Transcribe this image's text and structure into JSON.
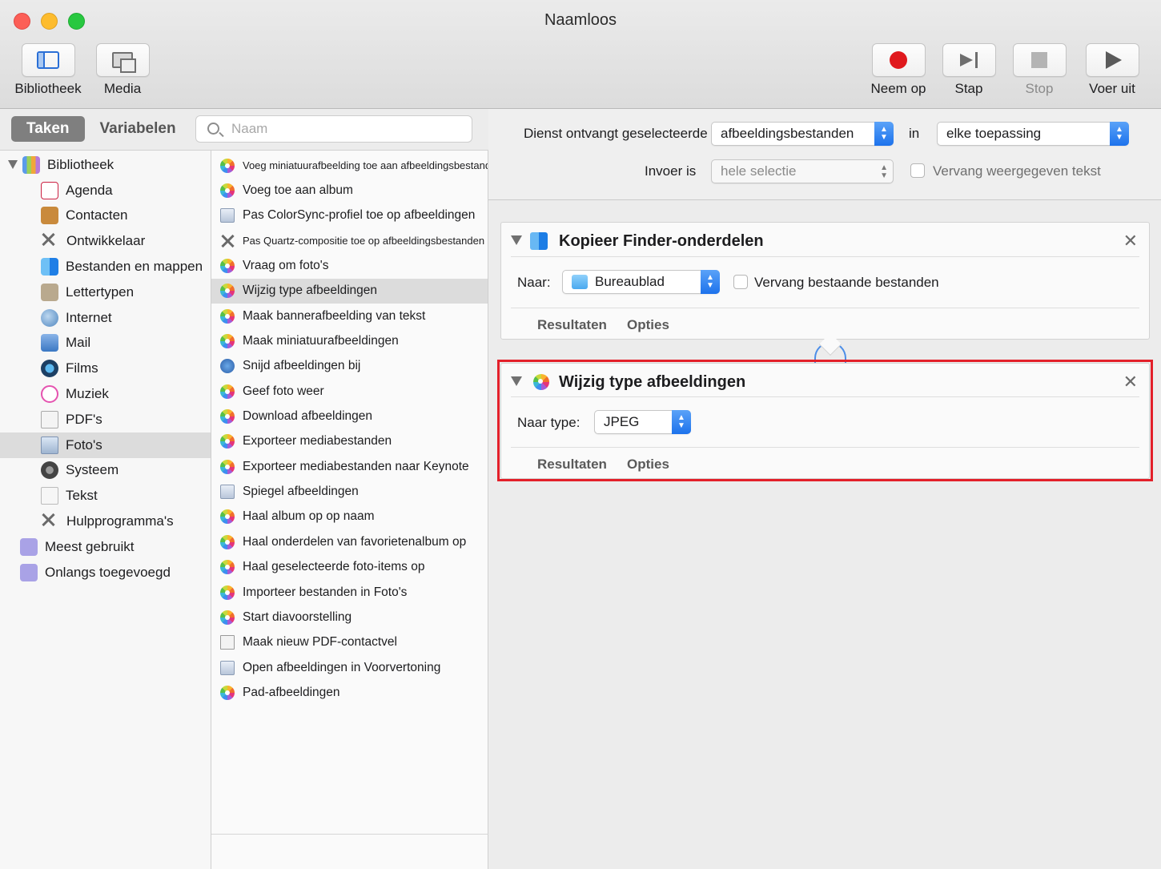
{
  "window": {
    "title": "Naamloos"
  },
  "toolbar": {
    "left": [
      {
        "label": "Bibliotheek",
        "icon": "library-icon"
      },
      {
        "label": "Media",
        "icon": "media-icon"
      }
    ],
    "right": [
      {
        "label": "Neem op",
        "icon": "record-icon"
      },
      {
        "label": "Stap",
        "icon": "step-icon"
      },
      {
        "label": "Stop",
        "icon": "stop-icon"
      },
      {
        "label": "Voer uit",
        "icon": "run-icon"
      }
    ]
  },
  "library": {
    "tabs": {
      "active": "Taken",
      "inactive": "Variabelen"
    },
    "search_placeholder": "Naam",
    "root": "Bibliotheek",
    "items": [
      "Agenda",
      "Contacten",
      "Ontwikkelaar",
      "Bestanden en mappen",
      "Lettertypen",
      "Internet",
      "Mail",
      "Films",
      "Muziek",
      "PDF's",
      "Foto's",
      "Systeem",
      "Tekst",
      "Hulpprogramma's"
    ],
    "selected": "Foto's",
    "smart_groups": [
      "Meest gebruikt",
      "Onlangs toegevoegd"
    ]
  },
  "actions": {
    "items": [
      "Voeg miniatuurafbeelding toe aan afbeeldingsbestanden",
      "Voeg toe aan album",
      "Pas ColorSync-profiel toe op afbeeldingen",
      "Pas Quartz-compositie toe op afbeeldingsbestanden",
      "Vraag om foto's",
      "Wijzig type afbeeldingen",
      "Maak bannerafbeelding van tekst",
      "Maak miniatuurafbeeldingen",
      "Snijd afbeeldingen bij",
      "Geef foto weer",
      "Download afbeeldingen",
      "Exporteer mediabestanden",
      "Exporteer mediabestanden naar Keynote",
      "Spiegel afbeeldingen",
      "Haal album op op naam",
      "Haal onderdelen van favorietenalbum op",
      "Haal geselecteerde foto-items op",
      "Importeer bestanden in Foto's",
      "Start diavoorstelling",
      "Maak nieuw PDF-contactvel",
      "Open afbeeldingen in Voorvertoning",
      "Pad-afbeeldingen"
    ],
    "selected": "Wijzig type afbeeldingen"
  },
  "service": {
    "receives_label": "Dienst ontvangt geselecteerde",
    "receives_value": "afbeeldingsbestanden",
    "in_label": "in",
    "in_value": "elke toepassing",
    "input_label": "Invoer is",
    "input_value": "hele selectie",
    "replace_label": "Vervang weergegeven tekst"
  },
  "workflow": {
    "copy_action": {
      "title": "Kopieer Finder-onderdelen",
      "to_label": "Naar:",
      "to_value": "Bureaublad",
      "replace_label": "Vervang bestaande bestanden",
      "tab_results": "Resultaten",
      "tab_options": "Opties"
    },
    "change_type_action": {
      "title": "Wijzig type afbeeldingen",
      "type_label": "Naar type:",
      "type_value": "JPEG",
      "tab_results": "Resultaten",
      "tab_options": "Opties"
    }
  },
  "colors": {
    "highlight_frame": "#e3202a",
    "popup_accent": "#1d72ec",
    "record": "#e0191d"
  }
}
